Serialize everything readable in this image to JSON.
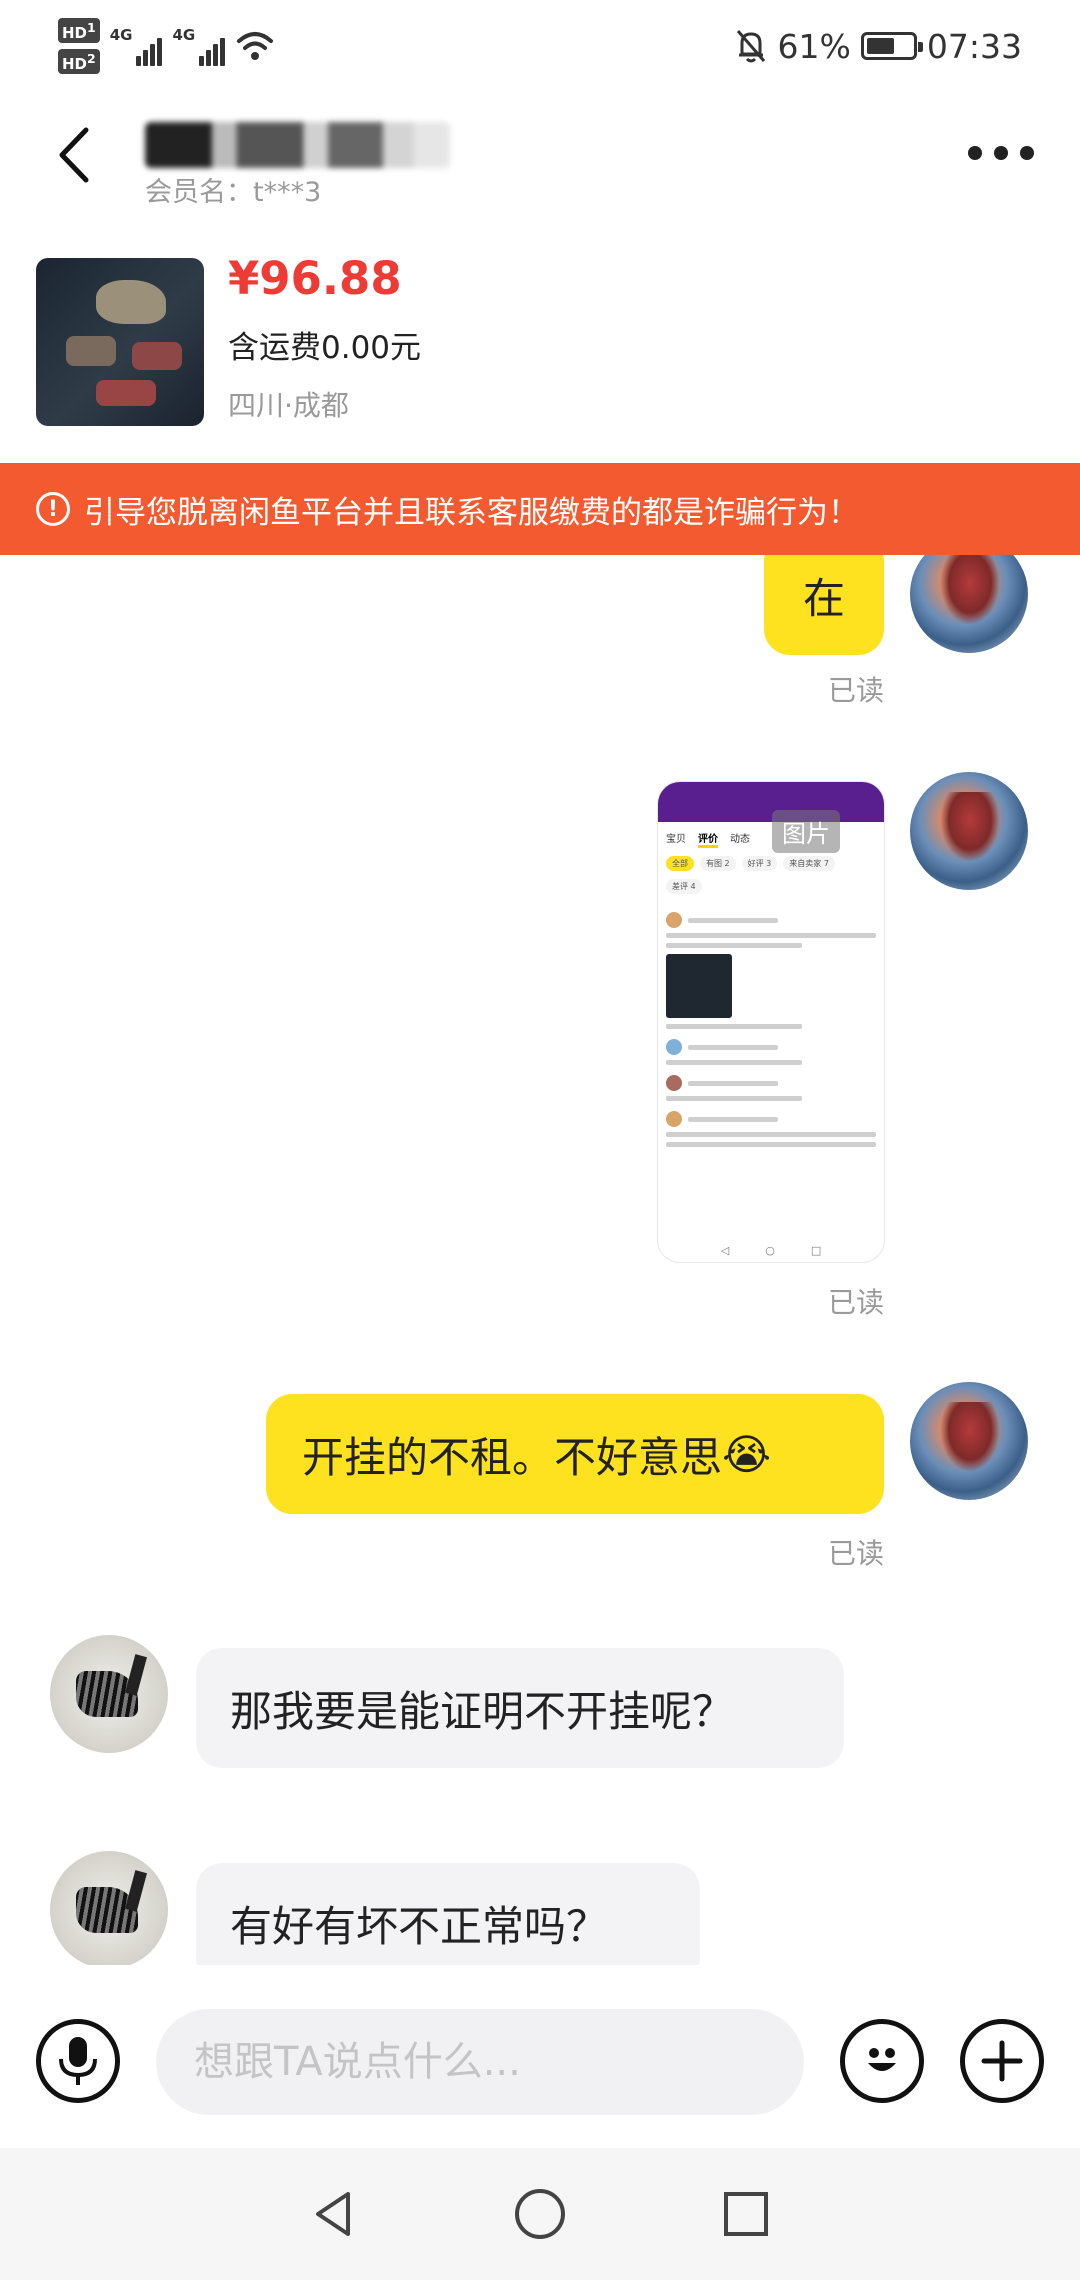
{
  "status_bar": {
    "sim1_label": "HD",
    "sim1_slot": "1",
    "sim2_label": "HD",
    "sim2_slot": "2",
    "network1": "4G",
    "network2": "4G",
    "battery_percent": "61%",
    "battery_level": 0.61,
    "time": "07:33"
  },
  "header": {
    "member_label": "会员名：t***3"
  },
  "product": {
    "price": "¥96.88",
    "shipping": "含运费0.00元",
    "location": "四川·成都"
  },
  "warning": {
    "icon": "!",
    "text": "引导您脱离闲鱼平台并且联系客服缴费的都是诈骗行为！"
  },
  "messages": [
    {
      "from": "self",
      "type": "text",
      "text": "在",
      "status": "已读"
    },
    {
      "from": "self",
      "type": "image",
      "label": "图片",
      "status": "已读"
    },
    {
      "from": "self",
      "type": "text",
      "text": "开挂的不租。不好意思",
      "emoji": "😭",
      "status": "已读"
    },
    {
      "from": "other",
      "type": "text",
      "text": "那我要是能证明不开挂呢？"
    },
    {
      "from": "other",
      "type": "text",
      "text": "有好有坏不正常吗？"
    }
  ],
  "image_preview": {
    "tabs": [
      "宝贝",
      "评价",
      "动态"
    ],
    "chips": [
      "全部",
      "有图 2",
      "好评 3",
      "来自卖家 7"
    ],
    "chip2": "差评 4"
  },
  "input": {
    "placeholder": "想跟TA说点什么..."
  },
  "icons": {
    "back": "chevron-left-icon",
    "more": "more-dots-icon",
    "voice": "microphone-icon",
    "emoji": "smiley-icon",
    "add": "plus-icon",
    "nav_back": "triangle-back-icon",
    "nav_home": "circle-home-icon",
    "nav_recent": "square-recent-icon"
  },
  "colors": {
    "accent_yellow": "#ffe21f",
    "price_red": "#ee3b36",
    "warning_orange": "#f45a2f"
  }
}
